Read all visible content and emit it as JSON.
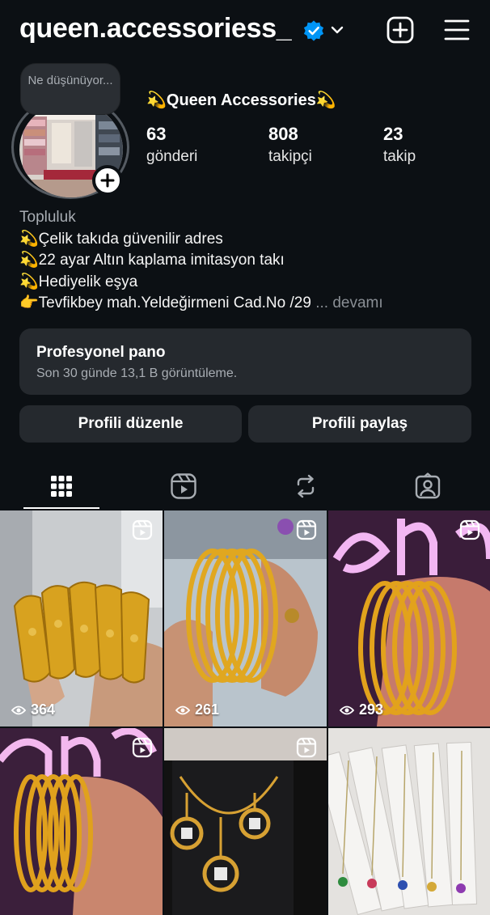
{
  "header": {
    "username": "queen.accessoriess_"
  },
  "note": {
    "text": "Ne düşünüyor..."
  },
  "profile": {
    "display_name": "💫Queen Accessories💫",
    "stats": [
      {
        "value": "63",
        "label": "gönderi"
      },
      {
        "value": "808",
        "label": "takipçi"
      },
      {
        "value": "23",
        "label": "takip"
      }
    ],
    "bio": {
      "category": "Topluluk",
      "lines": [
        "💫Çelik takıda güvenilir adres",
        "💫22 ayar Altın kaplama imitasyon takı",
        "💫Hediyelik eşya",
        "👉Tevfikbey mah.Yeldeğirmeni Cad.No /29"
      ],
      "more": "... devamı"
    }
  },
  "dashboard": {
    "title": "Profesyonel pano",
    "subtitle": "Son 30 günde 13,1 B görüntüleme."
  },
  "buttons": {
    "edit": "Profili düzenle",
    "share": "Profili paylaş"
  },
  "grid": {
    "posts": [
      {
        "views": "364"
      },
      {
        "views": "261"
      },
      {
        "views": "293"
      }
    ]
  }
}
